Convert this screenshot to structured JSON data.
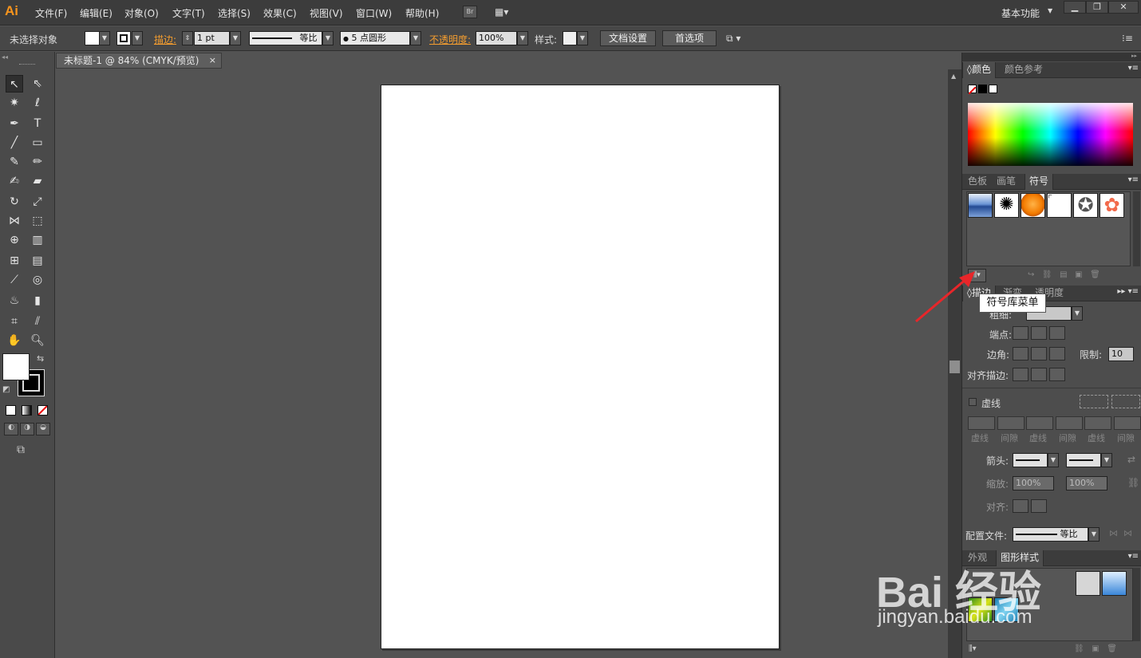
{
  "app": {
    "logo": "Ai"
  },
  "menu": [
    "文件(F)",
    "编辑(E)",
    "对象(O)",
    "文字(T)",
    "选择(S)",
    "效果(C)",
    "视图(V)",
    "窗口(W)",
    "帮助(H)"
  ],
  "bridge_label": "Br",
  "workspace": "基本功能",
  "control": {
    "selection": "未选择对象",
    "stroke_label": "描边:",
    "stroke_value": "1 pt",
    "stroke_profile": "等比",
    "brush": "5 点圆形",
    "opacity_label": "不透明度:",
    "opacity_value": "100%",
    "style_label": "样式:",
    "doc_setup": "文档设置",
    "prefs": "首选项"
  },
  "document": {
    "tab": "未标题-1 @ 84% (CMYK/预览)",
    "close": "×"
  },
  "color_panel": {
    "tabs": [
      "颜色",
      "颜色参考"
    ]
  },
  "swatch_panel": {
    "tabs": [
      "色板",
      "画笔",
      "符号"
    ],
    "active": "符号"
  },
  "tooltip": "符号库菜单",
  "stroke_panel": {
    "tabs": [
      "描边",
      "渐变",
      "透明度"
    ],
    "weight_label": "粗细:",
    "cap_label": "端点:",
    "corner_label": "边角:",
    "limit_label": "限制:",
    "limit_value": "10",
    "align_label": "对齐描边:",
    "dashed_label": "虚线",
    "dash_labels": [
      "虚线",
      "间隙",
      "虚线",
      "间隙",
      "虚线",
      "间隙"
    ],
    "arrow_label": "箭头:",
    "scale_label": "缩放:",
    "scale_values": [
      "100%",
      "100%"
    ],
    "align2_label": "对齐:",
    "profile_label": "配置文件:",
    "profile_value": "等比"
  },
  "appearance_panel": {
    "tabs": [
      "外观",
      "图形样式"
    ]
  },
  "watermark": {
    "main": "Bai 经验",
    "sub": "jingyan.baidu.com"
  }
}
